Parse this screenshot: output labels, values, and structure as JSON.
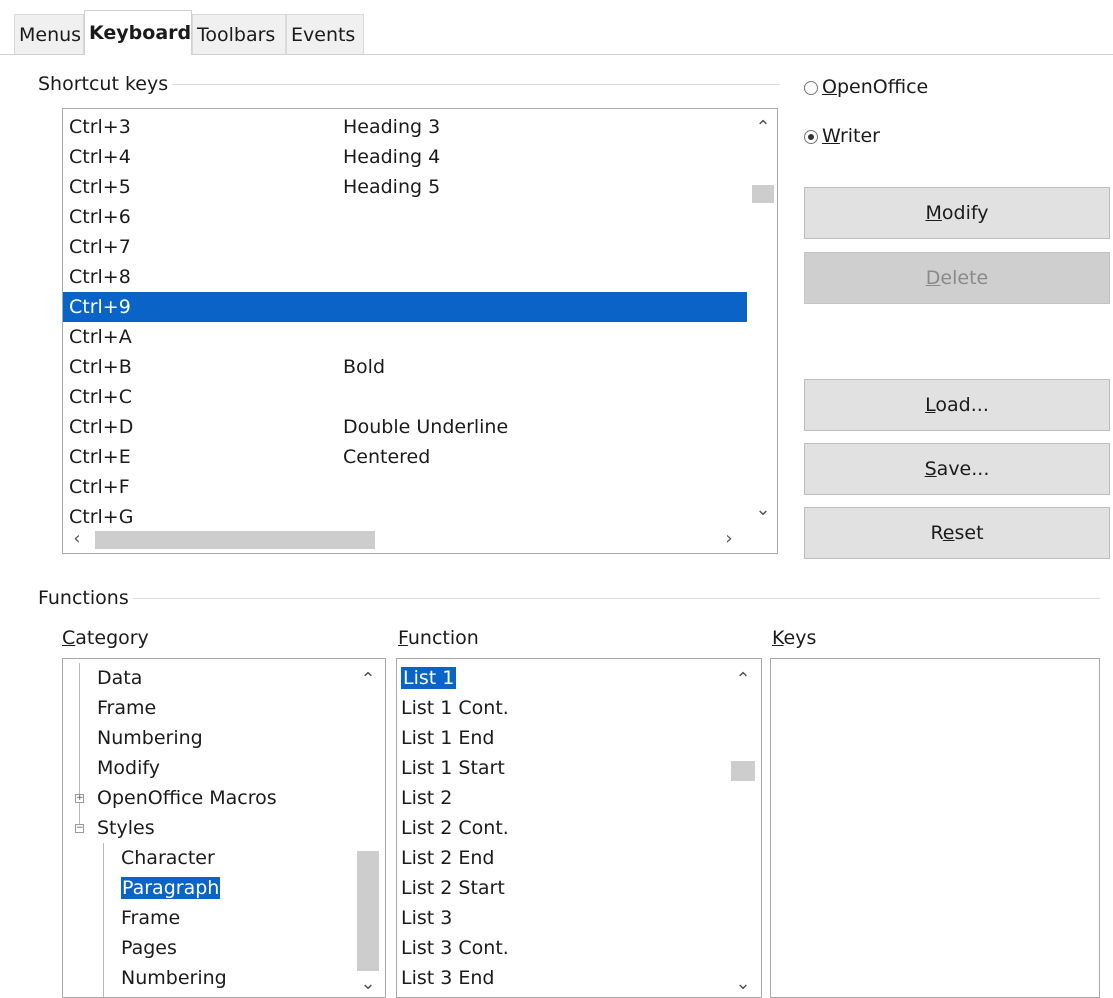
{
  "tabs": [
    "Menus",
    "Keyboard",
    "Toolbars",
    "Events"
  ],
  "active_tab": "Keyboard",
  "shortcut_keys": {
    "label": "Shortcut keys",
    "rows": [
      {
        "key": "Ctrl+3",
        "command": "Heading 3"
      },
      {
        "key": "Ctrl+4",
        "command": "Heading 4"
      },
      {
        "key": "Ctrl+5",
        "command": "Heading 5"
      },
      {
        "key": "Ctrl+6",
        "command": ""
      },
      {
        "key": "Ctrl+7",
        "command": ""
      },
      {
        "key": "Ctrl+8",
        "command": ""
      },
      {
        "key": "Ctrl+9",
        "command": ""
      },
      {
        "key": "Ctrl+A",
        "command": ""
      },
      {
        "key": "Ctrl+B",
        "command": "Bold"
      },
      {
        "key": "Ctrl+C",
        "command": ""
      },
      {
        "key": "Ctrl+D",
        "command": "Double Underline"
      },
      {
        "key": "Ctrl+E",
        "command": "Centered"
      },
      {
        "key": "Ctrl+F",
        "command": ""
      },
      {
        "key": "Ctrl+G",
        "command": ""
      }
    ],
    "selected_key": "Ctrl+9"
  },
  "scope": {
    "openoffice": "OpenOffice",
    "writer": "Writer",
    "selected": "Writer"
  },
  "buttons": {
    "modify": "Modify",
    "delete": "Delete",
    "load": "Load...",
    "save": "Save...",
    "reset": "Reset"
  },
  "functions": {
    "label": "Functions",
    "category_label": "Category",
    "function_label": "Function",
    "keys_label": "Keys",
    "categories": [
      {
        "label": "Data",
        "level": 1,
        "expander": ""
      },
      {
        "label": "Frame",
        "level": 1,
        "expander": ""
      },
      {
        "label": "Numbering",
        "level": 1,
        "expander": ""
      },
      {
        "label": "Modify",
        "level": 1,
        "expander": ""
      },
      {
        "label": "OpenOffice Macros",
        "level": 1,
        "expander": "+"
      },
      {
        "label": "Styles",
        "level": 1,
        "expander": "-"
      },
      {
        "label": "Character",
        "level": 2,
        "expander": ""
      },
      {
        "label": "Paragraph",
        "level": 2,
        "expander": ""
      },
      {
        "label": "Frame",
        "level": 2,
        "expander": ""
      },
      {
        "label": "Pages",
        "level": 2,
        "expander": ""
      },
      {
        "label": "Numbering",
        "level": 2,
        "expander": ""
      }
    ],
    "selected_category": "Paragraph",
    "function_list": [
      "List 1",
      "List 1 Cont.",
      "List 1 End",
      "List 1 Start",
      "List 2",
      "List 2 Cont.",
      "List 2 End",
      "List 2 Start",
      "List 3",
      "List 3 Cont.",
      "List 3 End"
    ],
    "selected_function": "List 1",
    "keys": []
  },
  "colors": {
    "selection": "#0a64c8",
    "button": "#e1e1e1",
    "button_disabled": "#cfcfcf",
    "scroll_thumb": "#cdcdcd"
  }
}
